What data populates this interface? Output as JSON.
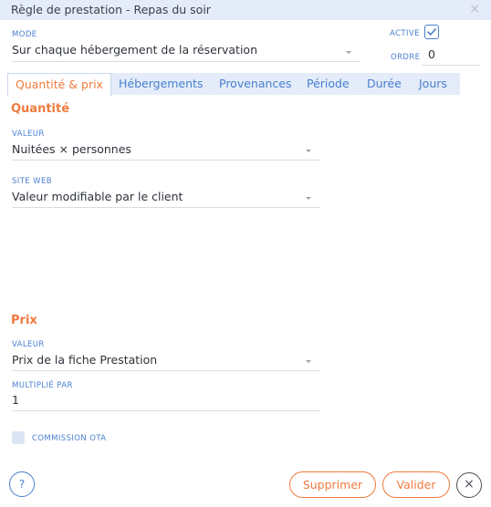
{
  "window": {
    "title": "Règle de prestation - Repas du soir",
    "close_icon": "×"
  },
  "mode": {
    "label": "MODE",
    "value": "Sur chaque hébergement de la réservation"
  },
  "active": {
    "label": "ACTIVE",
    "checked": true
  },
  "ordre": {
    "label": "ORDRE",
    "value": "0"
  },
  "tabs": [
    {
      "label": "Quantité & prix",
      "active": true
    },
    {
      "label": "Hébergements"
    },
    {
      "label": "Provenances"
    },
    {
      "label": "Période"
    },
    {
      "label": "Durée"
    },
    {
      "label": "Jours"
    }
  ],
  "quantite": {
    "title": "Quantité",
    "valeur": {
      "label": "VALEUR",
      "value": "Nuitées × personnes"
    },
    "site_web": {
      "label": "SITE WEB",
      "value": "Valeur modifiable par le client"
    }
  },
  "prix": {
    "title": "Prix",
    "valeur": {
      "label": "VALEUR",
      "value": "Prix de la fiche Prestation"
    },
    "multiplie_par": {
      "label": "MULTIPLIÉ PAR",
      "value": "1"
    }
  },
  "commission_ota": {
    "label": "COMMISSION OTA",
    "checked": false
  },
  "footer": {
    "help": "?",
    "supprimer": "Supprimer",
    "valider": "Valider",
    "close": "×"
  },
  "colors": {
    "accent": "#ef7a3d",
    "blue": "#4a7fd0",
    "tabbar": "#e3ecf8"
  }
}
